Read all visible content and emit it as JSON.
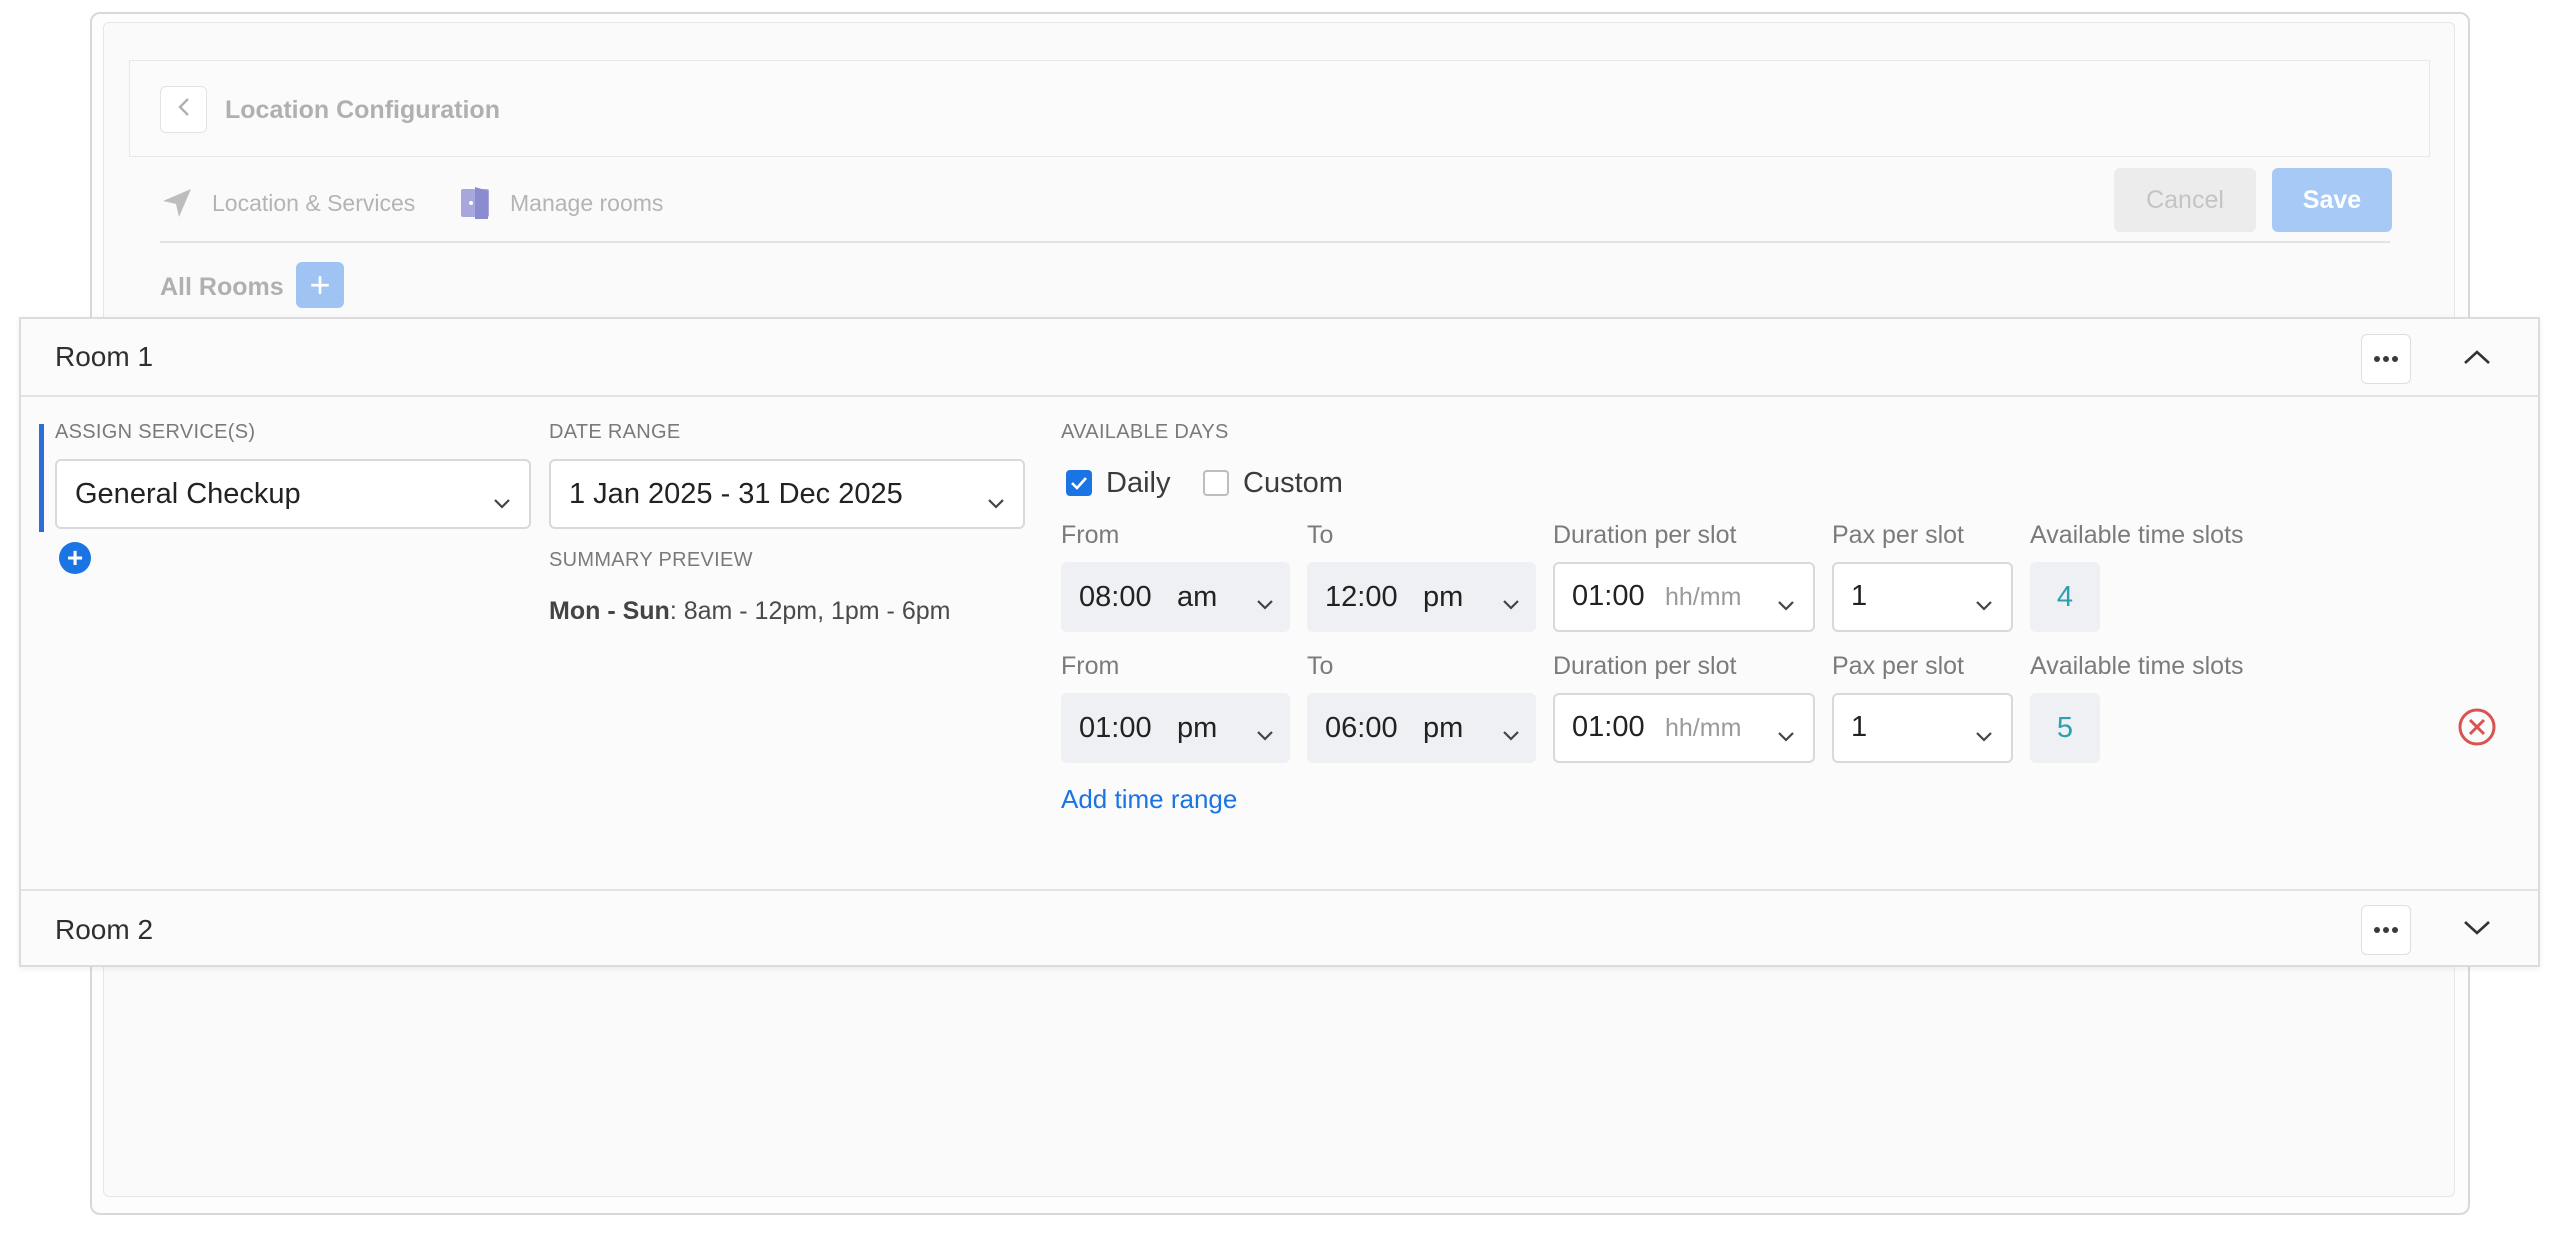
{
  "header": {
    "title": "Location Configuration",
    "tabs": [
      {
        "label": "Location & Services",
        "icon": "navigation-arrow-icon"
      },
      {
        "label": "Manage rooms",
        "icon": "door-icon"
      }
    ],
    "cancel_label": "Cancel",
    "save_label": "Save"
  },
  "rooms_section": {
    "title": "All Rooms",
    "add_label": "+"
  },
  "room1": {
    "title": "Room 1",
    "assign_services_label": "ASSIGN SERVICE(S)",
    "service_value": "General Checkup",
    "date_range_label": "DATE RANGE",
    "date_range_value": "1 Jan 2025 - 31 Dec 2025",
    "summary_label": "SUMMARY PREVIEW",
    "summary_days": "Mon - Sun",
    "summary_times": ": 8am - 12pm, 1pm - 6pm",
    "available_days_label": "AVAILABLE DAYS",
    "daily_label": "Daily",
    "daily_checked": true,
    "custom_label": "Custom",
    "custom_checked": false,
    "time_ranges": [
      {
        "from_label": "From",
        "from_time": "08:00",
        "from_period": "am",
        "to_label": "To",
        "to_time": "12:00",
        "to_period": "pm",
        "duration_label": "Duration per slot",
        "duration_value": "01:00",
        "duration_unit": "hh/mm",
        "pax_label": "Pax per slot",
        "pax_value": "1",
        "slots_label": "Available time slots",
        "slots_value": "4"
      },
      {
        "from_label": "From",
        "from_time": "01:00",
        "from_period": "pm",
        "to_label": "To",
        "to_time": "06:00",
        "to_period": "pm",
        "duration_label": "Duration per slot",
        "duration_value": "01:00",
        "duration_unit": "hh/mm",
        "pax_label": "Pax per slot",
        "pax_value": "1",
        "slots_label": "Available time slots",
        "slots_value": "5"
      }
    ],
    "add_time_range_label": "Add time range"
  },
  "room2": {
    "title": "Room 2"
  },
  "colors": {
    "accent": "#1b74e4",
    "slot_text": "#2aa0b0",
    "remove": "#d9534f"
  }
}
